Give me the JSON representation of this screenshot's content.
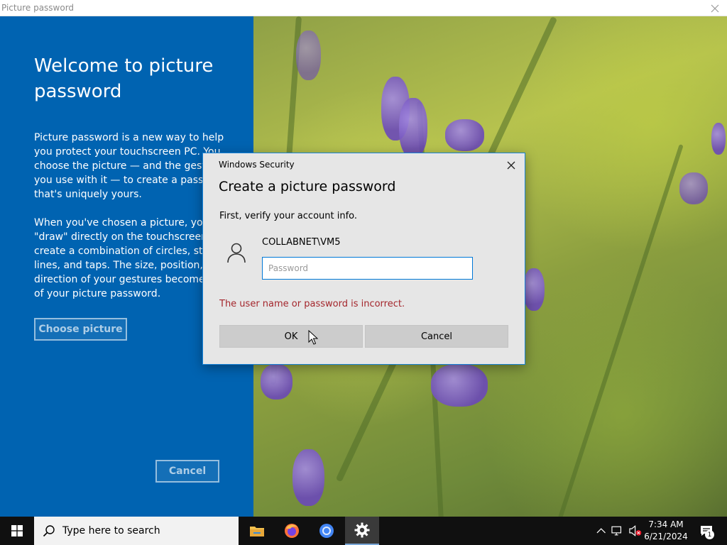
{
  "window": {
    "title": "Picture password"
  },
  "left_panel": {
    "heading": "Welcome to picture password",
    "paragraph1": "Picture password is a new way to help\nyou protect your touchscreen PC. You\nchoose the picture — and the gesture\nyou use with it — to create a password\nthat's uniquely yours.",
    "paragraph2": "When you've chosen a picture, you\n\"draw\" directly on the touchscreen to\ncreate a combination of circles, straight\nlines, and taps. The size, position, and\ndirection of your gestures become part\nof your picture password.",
    "choose_button": "Choose picture",
    "cancel_button": "Cancel"
  },
  "dialog": {
    "title": "Windows Security",
    "heading": "Create a picture password",
    "subtitle": "First, verify your account info.",
    "username": "COLLABNET\\VM5",
    "password_value": "",
    "password_placeholder": "Password",
    "error": "The user name or password is incorrect.",
    "ok_button": "OK",
    "cancel_button": "Cancel"
  },
  "taskbar": {
    "search_placeholder": "Type here to search",
    "apps": [
      "file-explorer-icon",
      "firefox-icon",
      "chrome-icon",
      "settings-icon"
    ],
    "active_app": "settings-icon",
    "time": "7:34 AM",
    "date": "6/21/2024",
    "notification_count": "1"
  },
  "colors": {
    "panel_blue": "#0063b1",
    "dialog_bg": "#e6e6e6",
    "accent": "#0078d7",
    "error_red": "#a4262c",
    "taskbar": "#101010"
  }
}
